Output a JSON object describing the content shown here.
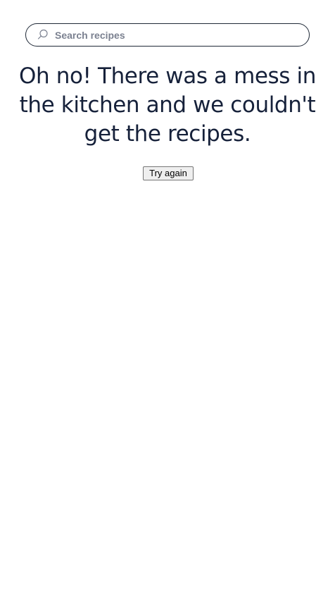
{
  "search": {
    "placeholder": "Search recipes",
    "value": "",
    "icon": "search-icon"
  },
  "error": {
    "message": "Oh no! There was a mess in the kitchen and we couldn't get the recipes."
  },
  "actions": {
    "retry_label": "Try again"
  },
  "colors": {
    "text": "#16213a",
    "placeholder": "#7b8190",
    "border": "#1f2937",
    "button_bg": "#efefef"
  }
}
